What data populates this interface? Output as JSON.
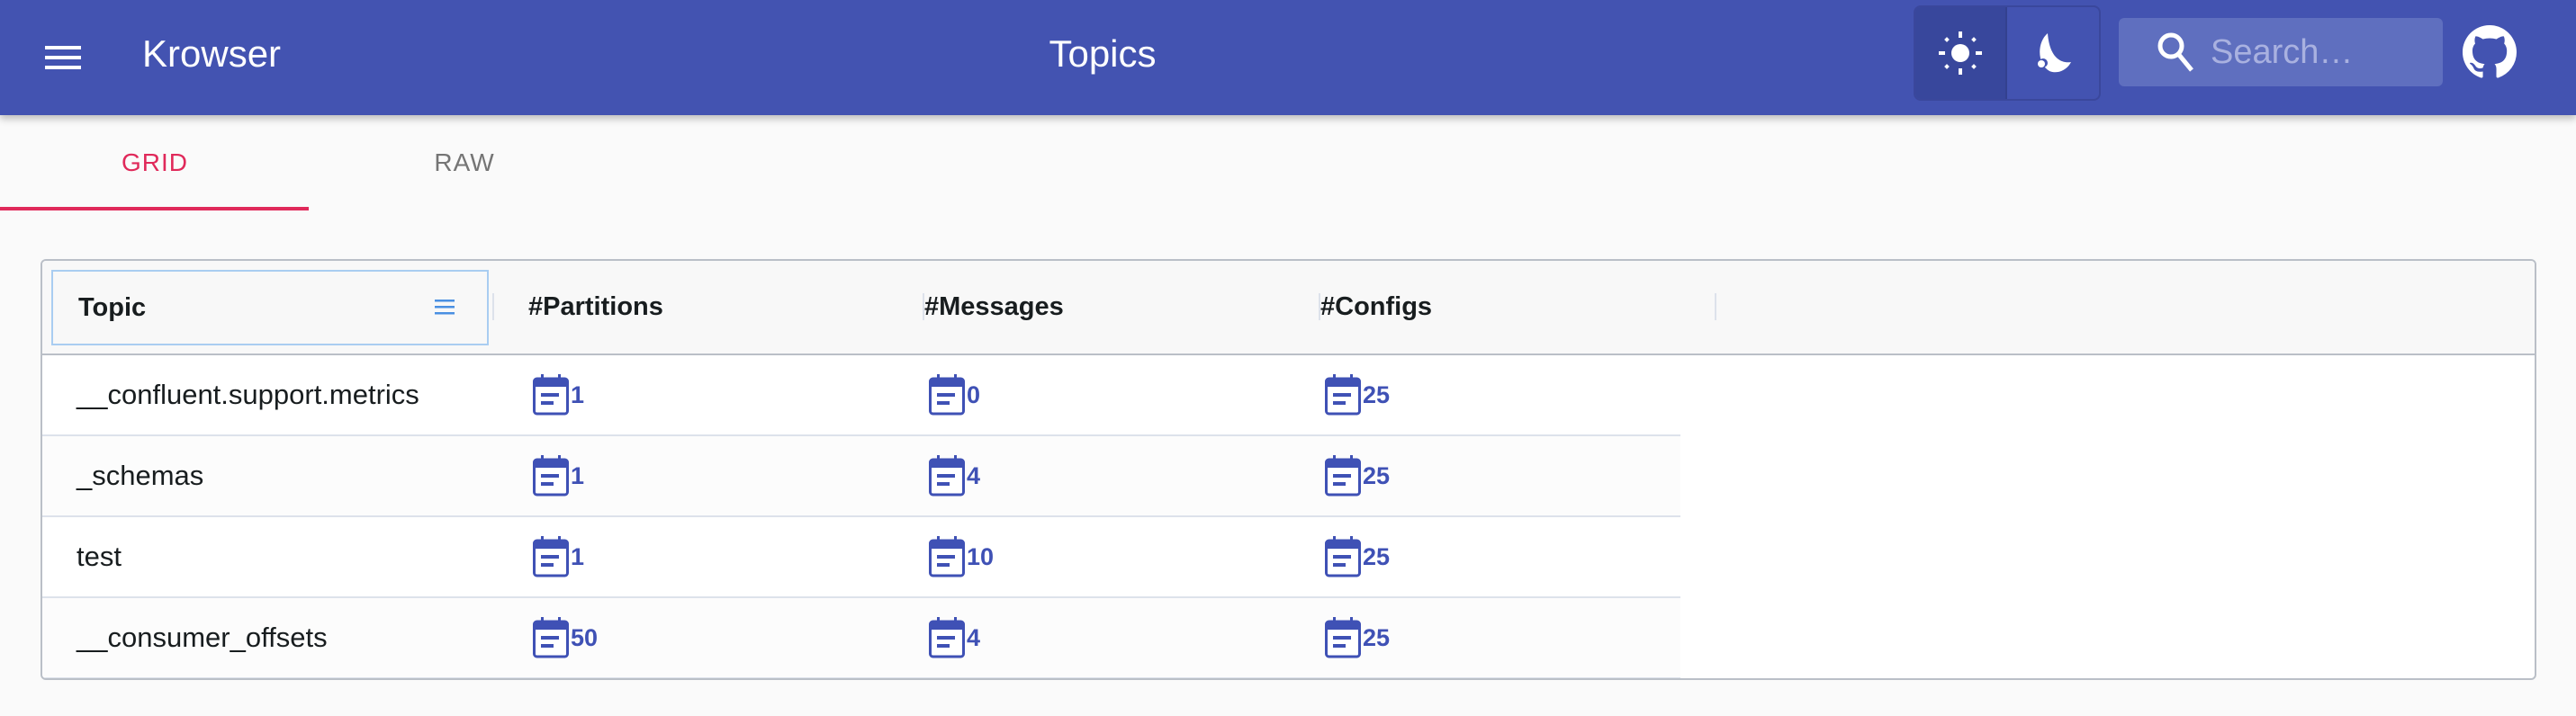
{
  "appbar": {
    "app_title": "Krowser",
    "page_title": "Topics",
    "menu_icon": "hamburger-menu-icon",
    "theme": {
      "light_icon": "sun-icon",
      "dark_icon": "moon-icon",
      "selected": "light"
    },
    "search": {
      "placeholder": "Search…",
      "value": "",
      "icon": "search-icon"
    },
    "github_icon": "github-icon"
  },
  "tabs": [
    {
      "label": "GRID",
      "active": true
    },
    {
      "label": "RAW",
      "active": false
    }
  ],
  "grid": {
    "columns": [
      "Topic",
      "#Partitions",
      "#Messages",
      "#Configs"
    ],
    "rows": [
      {
        "topic": "__confluent.support.metrics",
        "partitions": "1",
        "messages": "0",
        "configs": "25"
      },
      {
        "topic": "_schemas",
        "partitions": "1",
        "messages": "4",
        "configs": "25"
      },
      {
        "topic": "test",
        "partitions": "1",
        "messages": "10",
        "configs": "25"
      },
      {
        "topic": "__consumer_offsets",
        "partitions": "50",
        "messages": "4",
        "configs": "25"
      }
    ],
    "cell_icon": "list-details-icon"
  },
  "colors": {
    "primary": "#4353b1",
    "accent": "#e0295a",
    "link": "#3f51b5"
  }
}
